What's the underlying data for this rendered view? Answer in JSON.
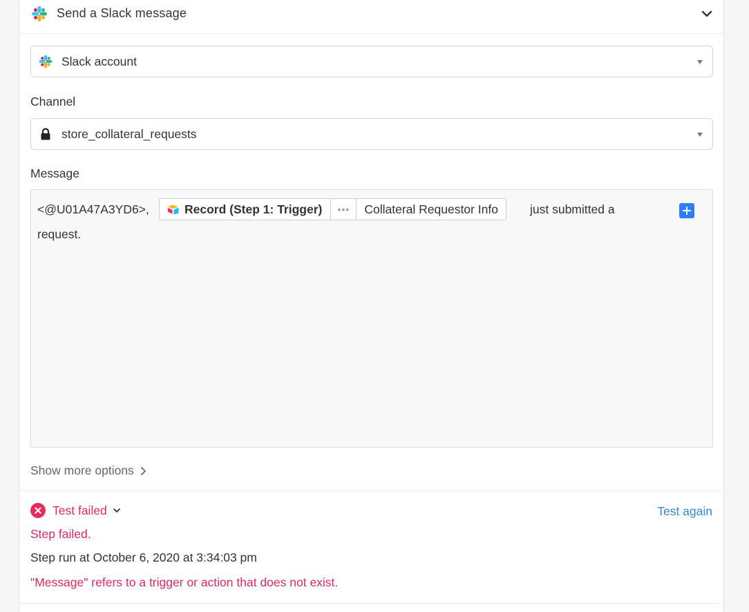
{
  "header": {
    "title": "Send a Slack message",
    "icon": "slack-logo-icon"
  },
  "account": {
    "label": "Slack account",
    "icon": "slack-logo-icon"
  },
  "channel": {
    "label": "Channel",
    "value": "store_collateral_requests",
    "icon": "lock-icon"
  },
  "message": {
    "label": "Message",
    "prefix": "<@U01A47A3YD6>,",
    "token": {
      "source": "Record (Step 1: Trigger)",
      "dots": "•••",
      "field": "Collateral Requestor Info",
      "icon": "airtable-logo-icon"
    },
    "suffix": "just submitted a",
    "line2": "request."
  },
  "options": {
    "show_more": "Show more options"
  },
  "test": {
    "status": "Test failed",
    "again": "Test again",
    "step_failed": "Step failed.",
    "step_run": "Step run at October 6, 2020 at 3:34:03 pm",
    "error": "\"Message\" refers to a trigger or action that does not exist."
  },
  "colors": {
    "error": "#e02861",
    "link": "#2d8bd6",
    "plus_button": "#2d7ff9"
  }
}
